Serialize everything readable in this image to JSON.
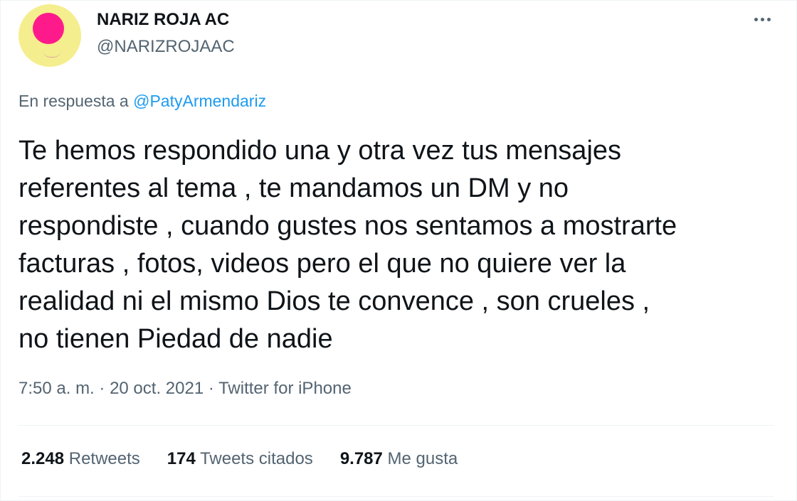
{
  "account": {
    "display_name": "NARIZ ROJA AC",
    "handle": "@NARIZROJAAC",
    "avatar_colors": {
      "background": "#f5ee8e",
      "nose": "#ff1a8c"
    }
  },
  "more_icon": "more-horizontal-icon",
  "reply": {
    "prefix": "En respuesta a",
    "mention": "@PatyArmendariz"
  },
  "tweet": {
    "text": "Te hemos respondido una y otra vez tus mensajes\nreferentes al tema , te mandamos un DM y no\nrespondiste , cuando gustes nos sentamos a mostrarte\nfacturas , fotos, videos pero el que no quiere ver la\nrealidad ni el mismo Dios te convence , son crueles ,\nno tienen Piedad de nadie"
  },
  "meta": {
    "time": "7:50 a. m.",
    "separator": " · ",
    "date": "20 oct. 2021",
    "source": "Twitter for iPhone"
  },
  "stats": {
    "retweets_count": "2.248",
    "retweets_label": "Retweets",
    "quotes_count": "174",
    "quotes_label": "Tweets citados",
    "likes_count": "9.787",
    "likes_label": "Me gusta"
  },
  "colors": {
    "text_primary": "#0f1419",
    "text_secondary": "#536471",
    "link": "#1d9bf0",
    "divider": "#eff3f4"
  }
}
